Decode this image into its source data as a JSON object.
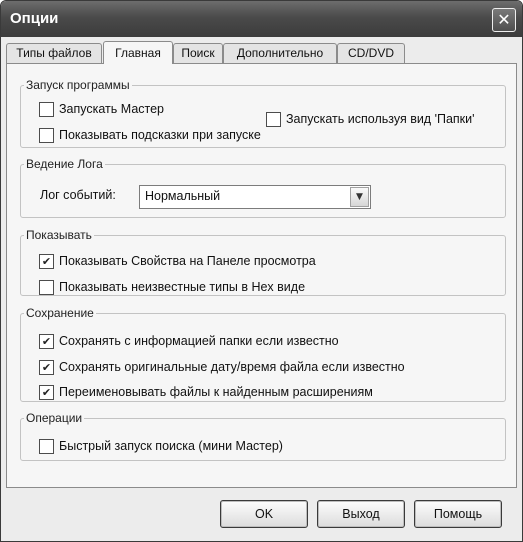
{
  "window": {
    "title": "Опции",
    "close_glyph": "✕"
  },
  "tabs": [
    {
      "label": "Типы файлов"
    },
    {
      "label": "Главная",
      "active": true
    },
    {
      "label": "Поиск"
    },
    {
      "label": "Дополнительно"
    },
    {
      "label": "CD/DVD"
    }
  ],
  "groups": {
    "launch": {
      "legend": "Запуск программы",
      "run_wizard": {
        "label": "Запускать Мастер",
        "checked": false
      },
      "folders_view": {
        "label": "Запускать используя вид 'Папки'",
        "checked": false
      },
      "show_tips": {
        "label": "Показывать подсказки при запуске",
        "checked": false
      }
    },
    "log": {
      "legend": "Ведение Лога",
      "event_log_label": "Лог событий:",
      "event_log_value": "Нормальный"
    },
    "show": {
      "legend": "Показывать",
      "props_in_preview": {
        "label": "Показывать Свойства на Панеле просмотра",
        "checked": true
      },
      "unknown_hex": {
        "label": "Показывать неизвестные типы в Hex виде",
        "checked": false
      }
    },
    "save": {
      "legend": "Сохранение",
      "save_folder_info": {
        "label": "Сохранять с информацией папки если известно",
        "checked": true
      },
      "save_original_datetime": {
        "label": "Сохранять оригинальные дату/время файла если известно",
        "checked": true
      },
      "rename_extensions": {
        "label": "Переименовывать файлы к найденным расширениям",
        "checked": true
      }
    },
    "operations": {
      "legend": "Операции",
      "quick_search": {
        "label": "Быстрый запуск поиска (мини Мастер)",
        "checked": false
      }
    }
  },
  "buttons": {
    "ok": "OK",
    "exit": "Выход",
    "help": "Помощь"
  },
  "glyphs": {
    "check": "✔",
    "dropdown": "▼"
  }
}
